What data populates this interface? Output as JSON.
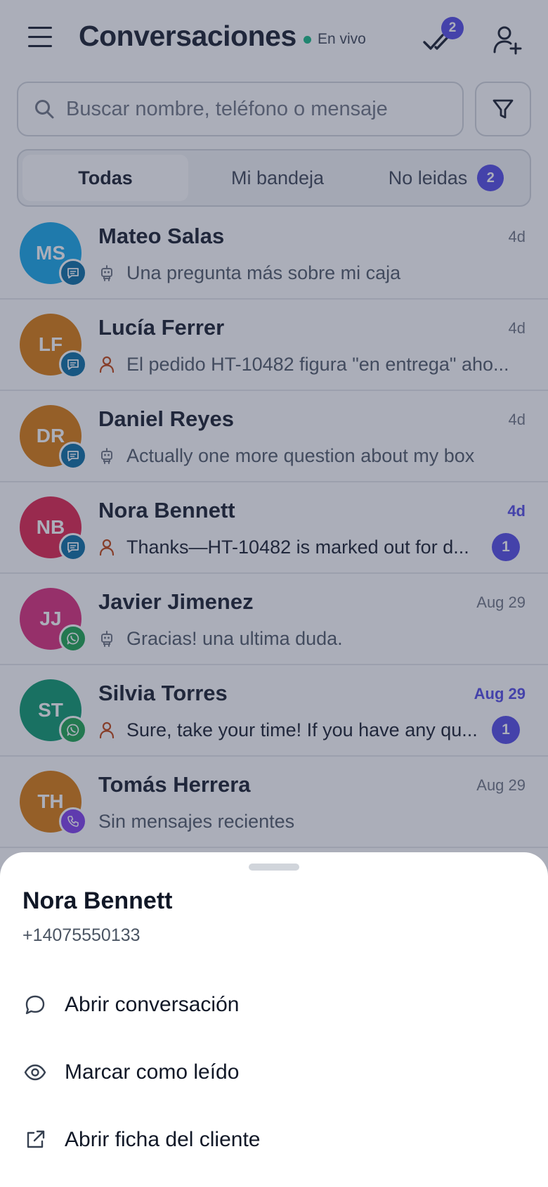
{
  "header": {
    "title": "Conversaciones",
    "live_label": "En vivo",
    "checks_badge": "2"
  },
  "search": {
    "placeholder": "Buscar nombre, teléfono o mensaje"
  },
  "tabs": [
    {
      "label": "Todas"
    },
    {
      "label": "Mi bandeja"
    },
    {
      "label": "No leidas",
      "badge": "2"
    }
  ],
  "conversations": [
    {
      "initials": "MS",
      "name": "Mateo Salas",
      "time": "4d",
      "preview": "Una pregunta más sobre mi caja",
      "author_icon": "bot-icon",
      "channel": "chat",
      "avatar_color": "#0ea5e9"
    },
    {
      "initials": "LF",
      "name": "Lucía Ferrer",
      "time": "4d",
      "preview": "El pedido HT-10482 figura \"en entrega\" aho...",
      "author_icon": "agent-icon",
      "channel": "chat",
      "avatar_color": "#d97706"
    },
    {
      "initials": "DR",
      "name": "Daniel Reyes",
      "time": "4d",
      "preview": "Actually one more question about my box",
      "author_icon": "bot-icon",
      "channel": "chat",
      "avatar_color": "#d97706"
    },
    {
      "initials": "NB",
      "name": "Nora Bennett",
      "time": "4d",
      "preview": "Thanks—HT-10482 is marked out for d...",
      "author_icon": "agent-icon",
      "channel": "chat",
      "avatar_color": "#e11d48",
      "unread": "1"
    },
    {
      "initials": "JJ",
      "name": "Javier Jimenez",
      "time": "Aug 29",
      "preview": "Gracias! una ultima duda.",
      "author_icon": "bot-icon",
      "channel": "whatsapp",
      "avatar_color": "#db2777"
    },
    {
      "initials": "ST",
      "name": "Silvia Torres",
      "time": "Aug 29",
      "preview": "Sure, take your time! If you have any qu...",
      "author_icon": "agent-icon",
      "channel": "whatsapp",
      "avatar_color": "#059669",
      "unread": "1"
    },
    {
      "initials": "TH",
      "name": "Tomás Herrera",
      "time": "Aug 29",
      "preview": "Sin mensajes recientes",
      "author_icon": "",
      "channel": "phone",
      "avatar_color": "#d97706"
    }
  ],
  "sheet": {
    "name": "Nora Bennett",
    "phone": "+14075550133",
    "actions": [
      {
        "label": "Abrir conversación",
        "icon": "chat-bubble-icon"
      },
      {
        "label": "Marcar como leído",
        "icon": "eye-icon"
      },
      {
        "label": "Abrir ficha del cliente",
        "icon": "external-link-icon"
      }
    ]
  },
  "colors": {
    "accent": "#4f46e5",
    "live": "#10b981",
    "chat_channel": "#0369a1",
    "whatsapp_channel": "#16a34a",
    "phone_channel": "#7c3aed",
    "agent_icon": "#c2410c"
  }
}
